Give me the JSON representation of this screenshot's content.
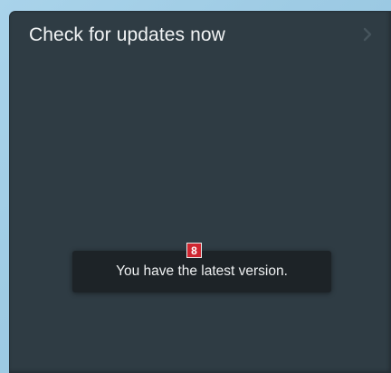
{
  "panel": {
    "title": "Check for updates now"
  },
  "toast": {
    "message": "You have the latest version."
  },
  "badge": {
    "label": "8"
  },
  "icons": {
    "chevron": "chevron-right-icon"
  },
  "colors": {
    "panel_bg": "#2f3c44",
    "toast_bg": "#1d2327",
    "badge_bg": "#cf2630",
    "outer_bg": "#9ecbe4"
  }
}
